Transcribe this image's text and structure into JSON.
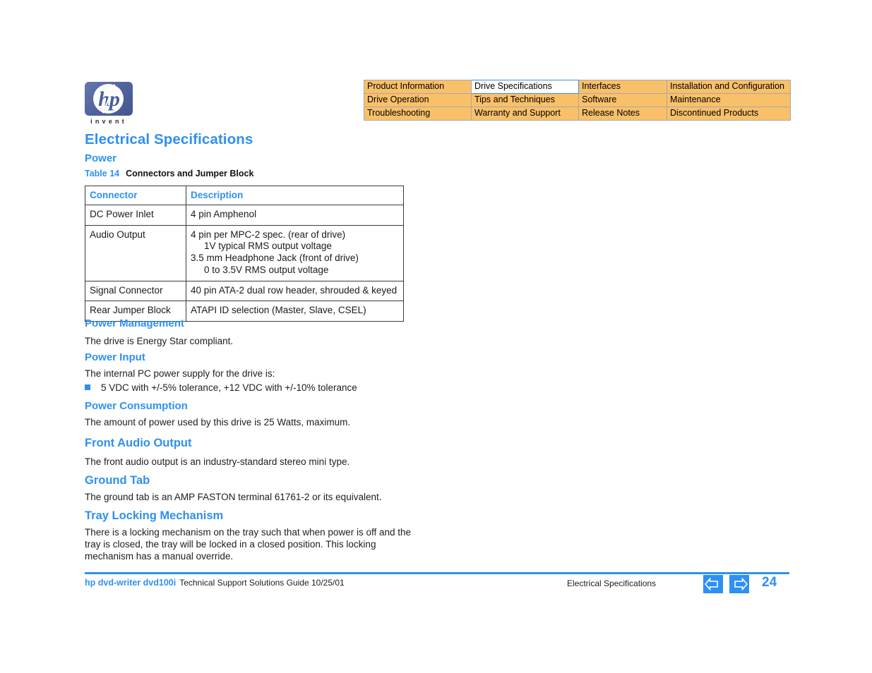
{
  "brand": {
    "logo_text": "hp",
    "logo_tagline": "invent",
    "accent_blue": "#2e90f2",
    "nav_orange": "#f9c06a"
  },
  "nav_table": {
    "rows": [
      [
        {
          "label": "Product Information",
          "current": false
        },
        {
          "label": "Drive Specifications",
          "current": true
        },
        {
          "label": "Interfaces",
          "current": false
        },
        {
          "label": "Installation and Configuration",
          "current": false
        }
      ],
      [
        {
          "label": "Drive Operation",
          "current": false
        },
        {
          "label": "Tips and Techniques",
          "current": false
        },
        {
          "label": "Software",
          "current": false
        },
        {
          "label": "Maintenance",
          "current": false
        }
      ],
      [
        {
          "label": "Troubleshooting",
          "current": false
        },
        {
          "label": "Warranty and Support",
          "current": false
        },
        {
          "label": "Release Notes",
          "current": false
        },
        {
          "label": "Discontinued Products",
          "current": false
        }
      ]
    ]
  },
  "page": {
    "title": "Electrical Specifications",
    "subtitle": "Power"
  },
  "table": {
    "caption_number": "Table 14",
    "caption_title": "Connectors and Jumper Block",
    "headers": [
      "Connector",
      "Description"
    ],
    "rows": [
      {
        "connector": "DC Power Inlet",
        "description_lines": [
          {
            "text": "4 pin Amphenol",
            "indent": false
          }
        ]
      },
      {
        "connector": "Audio Output",
        "description_lines": [
          {
            "text": "4 pin per MPC-2 spec. (rear of drive)",
            "indent": false
          },
          {
            "text": "1V typical RMS output voltage",
            "indent": true
          },
          {
            "text": "3.5 mm Headphone Jack (front of drive)",
            "indent": false
          },
          {
            "text": "0 to 3.5V RMS output voltage",
            "indent": true
          }
        ]
      },
      {
        "connector": "Signal Connector",
        "description_lines": [
          {
            "text": "40 pin ATA-2 dual row header, shrouded & keyed",
            "indent": false
          }
        ]
      },
      {
        "connector": "Rear Jumper Block",
        "description_lines": [
          {
            "text": "ATAPI ID selection (Master, Slave, CSEL)",
            "indent": false
          }
        ]
      }
    ]
  },
  "sections": {
    "power_management": {
      "heading": "Power Management",
      "body": "The drive is Energy Star compliant."
    },
    "power_input": {
      "heading": "Power Input",
      "body": "The internal PC power supply for the drive is:",
      "bullet": "5 VDC with +/-5% tolerance,  +12 VDC with +/-10% tolerance"
    },
    "power_consumption": {
      "heading": "Power Consumption",
      "body": "The amount of power used by this drive is 25 Watts, maximum."
    },
    "front_audio_output": {
      "heading": "Front Audio Output",
      "body": "The front audio output is an industry-standard stereo mini type."
    },
    "ground_tab": {
      "heading": "Ground Tab",
      "body": "The ground tab is an AMP FASTON terminal 61761-2 or its equivalent."
    },
    "tray_locking": {
      "heading": "Tray Locking Mechanism",
      "body": "There is a locking mechanism on the tray such that when power is off and the tray is closed, the tray will be locked in a closed position. This locking mechanism has a manual override."
    }
  },
  "footer": {
    "product": "hp dvd-writer  dvd100i",
    "guide": "Technical Support Solutions Guide 10/25/01",
    "section": "Electrical Specifications",
    "page_number": "24",
    "prev_icon": "arrow-left-icon",
    "next_icon": "arrow-right-icon"
  }
}
